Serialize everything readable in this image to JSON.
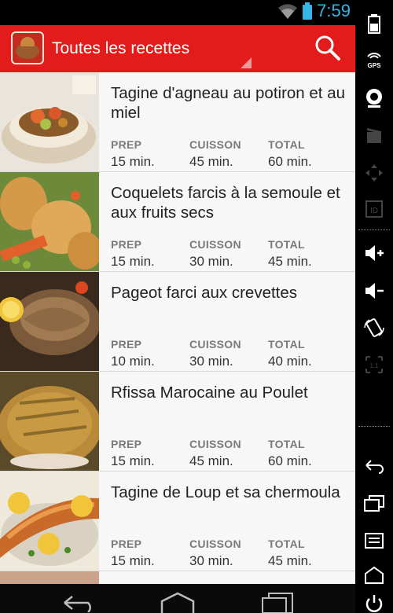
{
  "status_bar": {
    "time": "7:59",
    "color": "#33b5e5"
  },
  "action_bar": {
    "title": "Toutes les recettes",
    "color": "#e31b1b",
    "search_icon": "search-icon"
  },
  "labels": {
    "prep": "PREP",
    "cook": "CUISSON",
    "total": "TOTAL"
  },
  "recipes": [
    {
      "title": " Tagine d'agneau au potiron et au miel",
      "prep": "15 min.",
      "cook": "45 min.",
      "total": "60 min."
    },
    {
      "title": "Coquelets farcis à la semoule et aux fruits secs",
      "prep": "15 min.",
      "cook": "30 min.",
      "total": "45 min."
    },
    {
      "title": "Pageot farci aux crevettes",
      "prep": "10 min.",
      "cook": "30 min.",
      "total": "40 min."
    },
    {
      "title": "Rfissa Marocaine au Poulet",
      "prep": "15 min.",
      "cook": "45 min.",
      "total": "60 min."
    },
    {
      "title": "Tagine de  Loup et sa chermoula",
      "prep": "15 min.",
      "cook": "30 min.",
      "total": "45 min."
    }
  ],
  "sidebar_icons": [
    "battery-icon",
    "gps-icon",
    "camera-icon",
    "clapper-icon",
    "dpad-icon",
    "id-icon",
    "volume-up-icon",
    "volume-down-icon",
    "rotate-icon",
    "scale-icon",
    "back-icon",
    "recents-icon",
    "menu-icon",
    "home-icon",
    "power-icon"
  ],
  "nav_icons": [
    "back-icon",
    "home-icon",
    "recents-icon"
  ]
}
